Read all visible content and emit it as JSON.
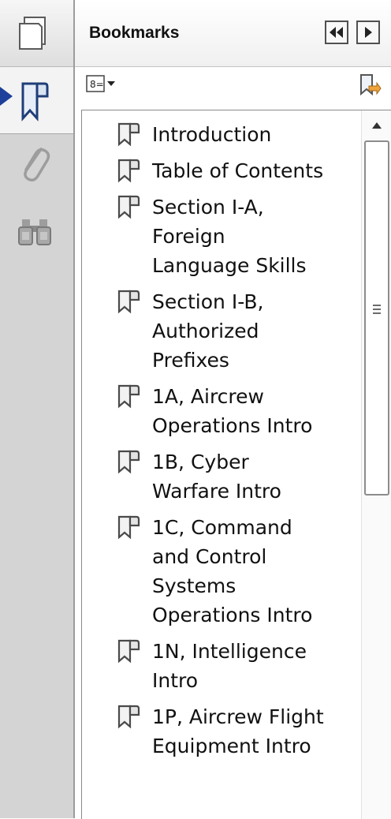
{
  "panel": {
    "title": "Bookmarks"
  },
  "rail": {
    "items": [
      {
        "name": "pages-thumbnails",
        "icon": "pages-icon",
        "active": false
      },
      {
        "name": "bookmarks",
        "icon": "bookmark-icon",
        "active": true
      },
      {
        "name": "attachments",
        "icon": "paperclip-icon",
        "active": false
      },
      {
        "name": "search",
        "icon": "binoculars-icon",
        "active": false
      }
    ]
  },
  "header_buttons": [
    {
      "name": "collapse-panel-button",
      "icon": "double-left-arrow-icon"
    },
    {
      "name": "expand-panel-button",
      "icon": "right-arrow-icon"
    }
  ],
  "toolbar": {
    "options_icon": "options-menu-icon",
    "action_icon": "bookmark-action-icon"
  },
  "bookmarks": [
    {
      "label": "Introduction"
    },
    {
      "label": "Table of Contents"
    },
    {
      "label": "Section I-A,\nForeign\nLanguage Skills"
    },
    {
      "label": "Section I-B,\nAuthorized\nPrefixes"
    },
    {
      "label": "1A, Aircrew\nOperations Intro"
    },
    {
      "label": "1B, Cyber\nWarfare Intro"
    },
    {
      "label": "1C, Command\nand Control\nSystems\nOperations Intro"
    },
    {
      "label": "1N, Intelligence\nIntro"
    },
    {
      "label": "1P, Aircrew Flight\nEquipment Intro"
    }
  ],
  "colors": {
    "rail_background": "#d4d4d4",
    "active_tab": "#f3f3f3",
    "pointer_arrow": "#1e3f9a"
  }
}
